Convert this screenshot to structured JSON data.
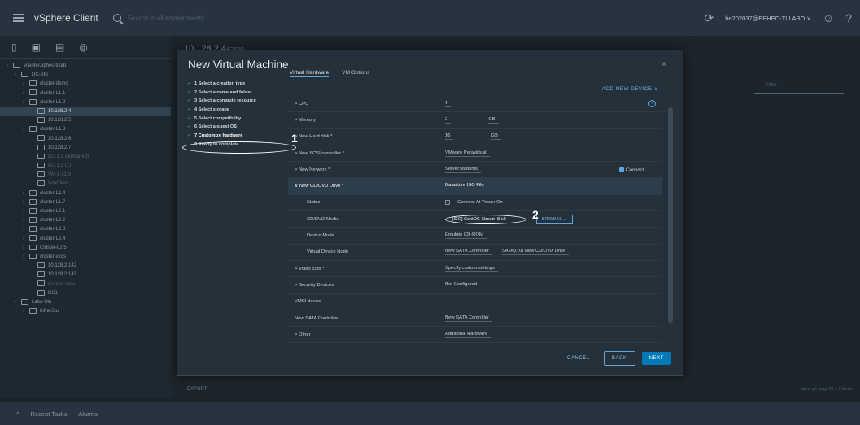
{
  "topbar": {
    "brand": "vSphere Client",
    "search_placeholder": "Search in all environments",
    "user": "he202037@EPHEC-TI.LABO ∨"
  },
  "background": {
    "header_title": "10.128.2.4",
    "actions_label": "ACTIONS",
    "filter_placeholder": "Filter",
    "export_label": "EXPORT",
    "per_page": "Items per page   35  ∨     2 items"
  },
  "tree": [
    {
      "label": "vcenter.ephec-ti.lab",
      "indent": 0,
      "sel": false,
      "dim": false
    },
    {
      "label": "DC-Stu",
      "indent": 1,
      "sel": false,
      "dim": false
    },
    {
      "label": "cluster-demo",
      "indent": 2,
      "sel": false,
      "dim": false
    },
    {
      "label": "cluster-L1.1",
      "indent": 2,
      "sel": false,
      "dim": false
    },
    {
      "label": "cluster-L1.2",
      "indent": 2,
      "sel": false,
      "dim": false
    },
    {
      "label": "10.128.2.4",
      "indent": 3,
      "sel": true,
      "dim": false
    },
    {
      "label": "10.128.2.5",
      "indent": 3,
      "sel": false,
      "dim": false
    },
    {
      "label": "cluster-L1.3",
      "indent": 2,
      "sel": false,
      "dim": false
    },
    {
      "label": "10.128.2.6",
      "indent": 3,
      "sel": false,
      "dim": false
    },
    {
      "label": "10.128.2.7",
      "indent": 3,
      "sel": false,
      "dim": false
    },
    {
      "label": "DC-1.3 (orphaned)",
      "indent": 3,
      "sel": false,
      "dim": true
    },
    {
      "label": "DC-1.3 (1)",
      "indent": 3,
      "sel": false,
      "dim": true
    },
    {
      "label": "VM-1-L1.3",
      "indent": 3,
      "sel": false,
      "dim": true
    },
    {
      "label": "WinClient",
      "indent": 3,
      "sel": false,
      "dim": true
    },
    {
      "label": "cluster-L1.4",
      "indent": 2,
      "sel": false,
      "dim": false
    },
    {
      "label": "cluster-L1.7",
      "indent": 2,
      "sel": false,
      "dim": false
    },
    {
      "label": "cluster-L2.1",
      "indent": 2,
      "sel": false,
      "dim": false
    },
    {
      "label": "cluster-L2.2",
      "indent": 2,
      "sel": false,
      "dim": false
    },
    {
      "label": "cluster-L2.3",
      "indent": 2,
      "sel": false,
      "dim": false
    },
    {
      "label": "cluster-L2.4",
      "indent": 2,
      "sel": false,
      "dim": false
    },
    {
      "label": "Cluster-L2.5",
      "indent": 2,
      "sel": false,
      "dim": false
    },
    {
      "label": "cluster-vvds",
      "indent": 2,
      "sel": false,
      "dim": false
    },
    {
      "label": "10.128.2.142",
      "indent": 3,
      "sel": false,
      "dim": false
    },
    {
      "label": "10.128.2.143",
      "indent": 3,
      "sel": false,
      "dim": false
    },
    {
      "label": "Centos-vvds",
      "indent": 3,
      "sel": false,
      "dim": true
    },
    {
      "label": "DC1",
      "indent": 3,
      "sel": false,
      "dim": false
    },
    {
      "label": "Labo-Stu",
      "indent": 1,
      "sel": false,
      "dim": false
    },
    {
      "label": "Infra-Stu",
      "indent": 2,
      "sel": false,
      "dim": false
    }
  ],
  "bottombar": {
    "recent_tasks": "Recent Tasks",
    "alarms": "Alarms"
  },
  "modal": {
    "title": "New Virtual Machine",
    "steps": [
      {
        "label": "1 Select a creation type",
        "state": "done"
      },
      {
        "label": "2 Select a name and folder",
        "state": "done"
      },
      {
        "label": "3 Select a compute resource",
        "state": "done"
      },
      {
        "label": "4 Select storage",
        "state": "done"
      },
      {
        "label": "5 Select compatibility",
        "state": "done"
      },
      {
        "label": "6 Select a guest OS",
        "state": "done"
      },
      {
        "label": "7 Customize hardware",
        "state": "current"
      },
      {
        "label": "8 Ready to complete",
        "state": "pending"
      }
    ],
    "tabs": [
      "Virtual Hardware",
      "VM Options"
    ],
    "add_device": "ADD NEW DEVICE ∨",
    "annotation_1": "1",
    "annotation_2": "2",
    "rows": [
      {
        "label": "> CPU",
        "value": "1",
        "extra": "",
        "sub": false,
        "hl": false,
        "info": true
      },
      {
        "label": "> Memory",
        "value": "2",
        "extra": "GB",
        "sub": false,
        "hl": false
      },
      {
        "label": "> New Hard disk *",
        "value": "16",
        "extra": "GB",
        "sub": false,
        "hl": false
      },
      {
        "label": "> New SCSI controller *",
        "value": "VMware Paravirtual",
        "extra": "",
        "sub": false,
        "hl": false
      },
      {
        "label": "> New Network *",
        "value": "ServerStudents",
        "extra": "Connect...",
        "sub": false,
        "hl": false
      },
      {
        "label": "∨ New CD/DVD Drive *",
        "value": "Datastore ISO File",
        "extra": "",
        "sub": false,
        "hl": true
      },
      {
        "label": "Status",
        "value": "Connect At Power On",
        "extra": "",
        "sub": true,
        "hl": false
      },
      {
        "label": "CD/DVD Media",
        "value": "[ISO] CentOS-Stream-8-x8",
        "extra": "BROWSE...",
        "sub": true,
        "hl": false
      },
      {
        "label": "Device Mode",
        "value": "Emulate CD-ROM",
        "extra": "",
        "sub": true,
        "hl": false
      },
      {
        "label": "Virtual Device Node",
        "value": "New SATA Controller",
        "extra": "SATA(0:0) New CD/DVD Drive",
        "sub": true,
        "hl": false
      },
      {
        "label": "> Video card *",
        "value": "Specify custom settings",
        "extra": "",
        "sub": false,
        "hl": false
      },
      {
        "label": "> Security Devices",
        "value": "Not Configured",
        "extra": "",
        "sub": false,
        "hl": false
      },
      {
        "label": "VMCI device",
        "value": "",
        "extra": "",
        "sub": false,
        "hl": false
      },
      {
        "label": "New SATA Controller",
        "value": "New SATA Controller",
        "extra": "",
        "sub": false,
        "hl": false
      },
      {
        "label": "> Other",
        "value": "Additional Hardware",
        "extra": "",
        "sub": false,
        "hl": false
      }
    ],
    "buttons": {
      "cancel": "CANCEL",
      "back": "BACK",
      "next": "NEXT"
    }
  }
}
